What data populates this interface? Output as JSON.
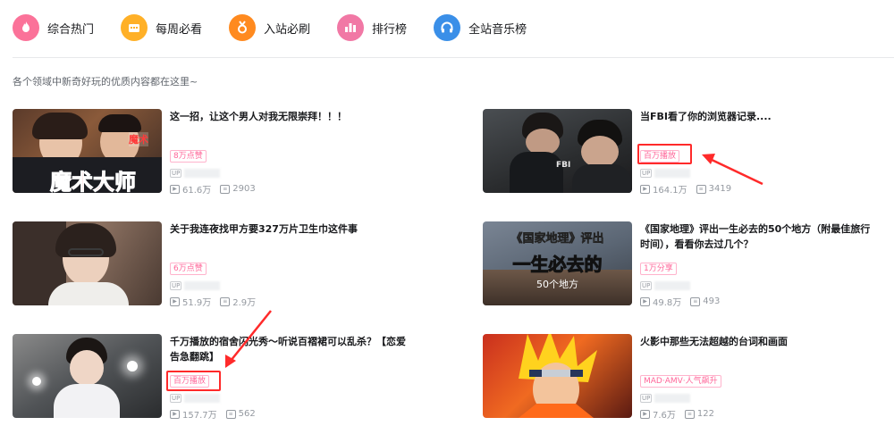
{
  "tabs": [
    {
      "label": "综合热门",
      "icon": "flame-icon",
      "color": "#fb7299"
    },
    {
      "label": "每周必看",
      "icon": "calendar-icon",
      "color": "#ffb027"
    },
    {
      "label": "入站必刷",
      "icon": "medal-icon",
      "color": "#ff8a1f"
    },
    {
      "label": "排行榜",
      "icon": "bar-chart-icon",
      "color": "#f178a5"
    },
    {
      "label": "全站音乐榜",
      "icon": "headphones-icon",
      "color": "#3a8fe8"
    }
  ],
  "subtitle": "各个领域中新奇好玩的优质内容都在这里~",
  "up_tag": "UP",
  "cards": [
    {
      "title": "这一招，让这个男人对我无限崇拜！！！",
      "badge": "8万点赞",
      "views": "61.6万",
      "danmaku": "2903",
      "thumb_text": "魔术大师",
      "thumb_tag": "魔术"
    },
    {
      "title": "当FBI看了你的浏览器记录....",
      "badge": "百万播放",
      "views": "164.1万",
      "danmaku": "3419",
      "thumb_text": "FBI"
    },
    {
      "title": "关于我连夜找甲方要327万片卫生巾这件事",
      "badge": "6万点赞",
      "views": "51.9万",
      "danmaku": "2.9万"
    },
    {
      "title": "《国家地理》评出一生必去的50个地方（附最佳旅行时间），看看你去过几个？",
      "badge": "1万分享",
      "views": "49.8万",
      "danmaku": "493",
      "thumb_line1": "《国家地理》评出",
      "thumb_line2": "一生必去的",
      "thumb_line3": "50个地方"
    },
    {
      "title": "千万播放的宿舍闪光秀～听说百褶裙可以乱杀？【恋爱告急翻跳】",
      "badge": "百万播放",
      "views": "157.7万",
      "danmaku": "562"
    },
    {
      "title": "火影中那些无法超越的台词和画面",
      "badge": "MAD·AMV·人气飙升",
      "views": "7.6万",
      "danmaku": "122"
    }
  ]
}
